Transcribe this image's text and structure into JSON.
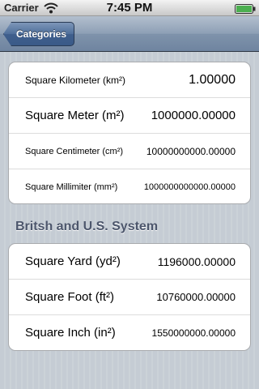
{
  "status_bar": {
    "carrier": "Carrier",
    "time": "7:45 PM"
  },
  "nav_bar": {
    "back_label": "Categories",
    "accent_color": "#4f6f9b"
  },
  "metric_group": {
    "rows": [
      {
        "label": "Square Kilometer (km²)",
        "value": "1.00000"
      },
      {
        "label": "Square Meter (m²)",
        "value": "1000000.00000"
      },
      {
        "label": "Square Centimeter (cm²)",
        "value": "10000000000.00000"
      },
      {
        "label": "Square Millimiter (mm²)",
        "value": "1000000000000.00000"
      }
    ]
  },
  "british_group": {
    "header": "Britsh and U.S. System",
    "rows": [
      {
        "label": "Square Yard (yd²)",
        "value": "1196000.00000"
      },
      {
        "label": "Square Foot (ft²)",
        "value": "10760000.00000"
      },
      {
        "label": "Square Inch (in²)",
        "value": "1550000000.00000"
      }
    ]
  }
}
